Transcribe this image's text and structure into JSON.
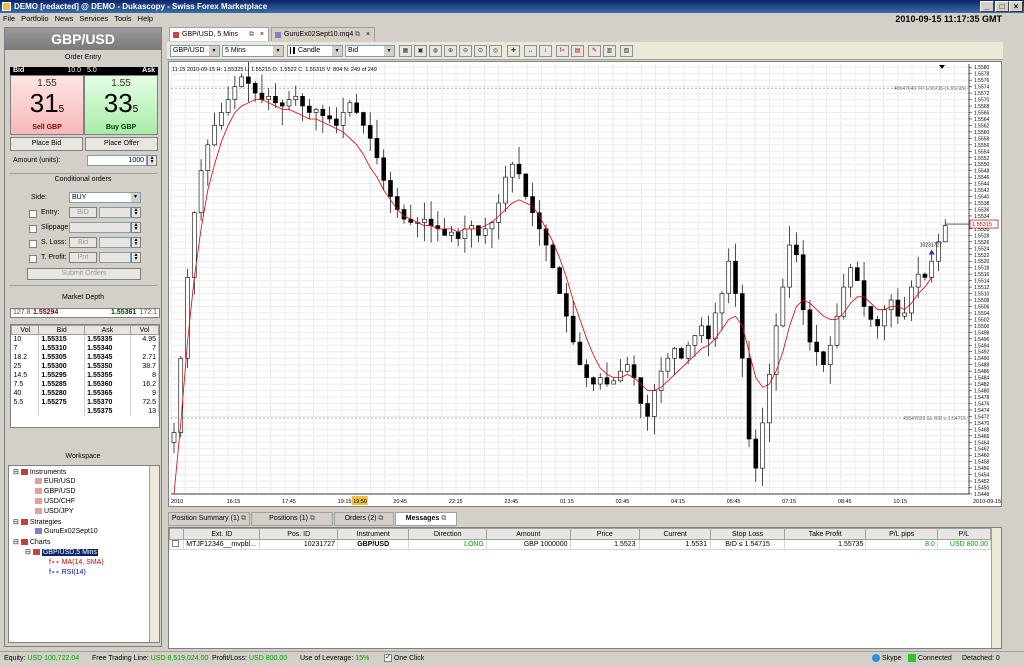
{
  "window": {
    "title": "DEMO [redacted] @ DEMO - Dukascopy - Swiss Forex Marketplace",
    "datetime": "2010-09-15 11:17:35 GMT"
  },
  "menu": [
    "File",
    "Portfolio",
    "News",
    "Services",
    "Tools",
    "Help"
  ],
  "dealing": {
    "pair": "GBP/USD",
    "order_entry_label": "Order Entry",
    "bid_label": "Bid",
    "bid_size": "10.0",
    "ask_label": "Ask",
    "ask_size": "5.0",
    "bid_small": "1.55",
    "bid_big": "31",
    "bid_pip": "5",
    "sell_label": "Sell GBP",
    "ask_small": "1.55",
    "ask_big": "33",
    "ask_pip": "5",
    "buy_label": "Buy GBP",
    "place_bid": "Place Bid",
    "place_offer": "Place Offer",
    "amount_label": "Amount (units):",
    "amount_value": "1000",
    "conditional_label": "Conditional orders",
    "side_label": "Side:",
    "side_value": "BUY",
    "entry_label": "Entry:",
    "entry_type": "BID",
    "slippage_label": "Slippage:",
    "sl_label": "S. Loss:",
    "sl_type": "Bid",
    "tp_label": "T. Profit:",
    "tp_type": "Pnt",
    "submit_label": "Submit Orders"
  },
  "market_depth": {
    "label": "Market Depth",
    "top_bid_vol": "127.8",
    "top_bid": "1.55294",
    "top_ask": "1.55361",
    "top_ask_vol": "172.1",
    "headers": [
      "Vol",
      "Bid",
      "Ask",
      "Vol"
    ],
    "rows": [
      [
        "10",
        "1.55315",
        "1.55335",
        "4.95"
      ],
      [
        "7",
        "1.55310",
        "1.55340",
        "7"
      ],
      [
        "18.2",
        "1.55305",
        "1.55345",
        "2.71"
      ],
      [
        "25",
        "1.55300",
        "1.55350",
        "38.7"
      ],
      [
        "14.5",
        "1.55295",
        "1.55355",
        "8"
      ],
      [
        "7.5",
        "1.55285",
        "1.55360",
        "16.2"
      ],
      [
        "40",
        "1.55280",
        "1.55365",
        "9"
      ],
      [
        "5.5",
        "1.55275",
        "1.55370",
        "72.5"
      ],
      [
        "",
        "",
        "1.55375",
        "13"
      ]
    ]
  },
  "workspace": {
    "label": "Workspace",
    "instruments_label": "Instruments",
    "instruments": [
      "EUR/USD",
      "GBP/USD",
      "USD/CHF",
      "USD/JPY"
    ],
    "strategies_label": "Strategies",
    "strategies": [
      "GuruEx02Sept10"
    ],
    "charts_label": "Charts",
    "chart_item": "GBP/USD,5 Mins",
    "indicators": [
      "f∘∘ MA(14, SMA)",
      "f∘∘ RSI(14)"
    ]
  },
  "tabs": [
    {
      "label": "GBP/USD, 5 Mins"
    },
    {
      "label": "GuruEx02Sept10.mq4"
    }
  ],
  "toolbar": {
    "instrument": "GBP/USD",
    "period": "5 Mins",
    "type": "Candle",
    "side": "Bid"
  },
  "chart_data": {
    "type": "candlestick",
    "info_line": "11:15 2010-09-15 H: 1.55325 L: 1.55215 O: 1.5522 C: 1.55315 V: 804 N: 249 of 249",
    "y_ticks": [
      "1.5580",
      "1.5578",
      "1.5576",
      "1.5574",
      "1.5572",
      "1.5570",
      "1.5568",
      "1.5566",
      "1.5564",
      "1.5562",
      "1.5560",
      "1.5558",
      "1.5556",
      "1.5554",
      "1.5552",
      "1.5550",
      "1.5548",
      "1.5546",
      "1.5544",
      "1.5542",
      "1.5540",
      "1.5538",
      "1.5536",
      "1.5534",
      "1.5532",
      "1.5530",
      "1.5528",
      "1.5526",
      "1.5524",
      "1.5522",
      "1.5520",
      "1.5518",
      "1.5516",
      "1.5514",
      "1.5512",
      "1.5510",
      "1.5508",
      "1.5506",
      "1.5504",
      "1.5502",
      "1.5500",
      "1.5498",
      "1.5496",
      "1.5494",
      "1.5492",
      "1.5490",
      "1.5488",
      "1.5486",
      "1.5484",
      "1.5482",
      "1.5480",
      "1.5478",
      "1.5476",
      "1.5474",
      "1.5472",
      "1.5470",
      "1.5468",
      "1.5466",
      "1.5464",
      "1.5462",
      "1.5460",
      "1.5458",
      "1.5456",
      "1.5454",
      "1.5452",
      "1.5450",
      "1.5448"
    ],
    "ylim": [
      1.5448,
      1.5581
    ],
    "x_ticks": [
      "2010",
      "16:15",
      "17:45",
      "19:15",
      "20:45",
      "22:15",
      "23:45",
      "01:15",
      "02:45",
      "04:15",
      "05:45",
      "07:15",
      "08:45",
      "10:15",
      "2010-09-15"
    ],
    "x_cursor_label": "19:50",
    "current_price_label": "1.55315",
    "current_price": 1.55315,
    "tp_line": {
      "label": "49547640 TP 1.55735 (1.55735)",
      "value": 1.55735
    },
    "sl_line": {
      "label": "49547639 SL BID ≤ 1.54715",
      "value": 1.54715
    },
    "position_label": "10231727",
    "ma_color": "#e00000",
    "up_color": "#ffffff",
    "down_color": "#000000",
    "ma_label": "MA(14, SMA)",
    "close_path": [
      1.5467,
      1.549,
      1.5515,
      1.5535,
      1.5548,
      1.5556,
      1.5562,
      1.5566,
      1.557,
      1.5574,
      1.5577,
      1.5575,
      1.5572,
      1.557,
      1.5571,
      1.5569,
      1.5568,
      1.557,
      1.5571,
      1.5568,
      1.5566,
      1.5567,
      1.5565,
      1.5564,
      1.5562,
      1.5566,
      1.5569,
      1.5566,
      1.5562,
      1.5558,
      1.5552,
      1.5545,
      1.554,
      1.5536,
      1.5533,
      1.5532,
      1.5532,
      1.5533,
      1.5531,
      1.553,
      1.5528,
      1.5529,
      1.5527,
      1.553,
      1.5531,
      1.5528,
      1.553,
      1.5532,
      1.5538,
      1.5546,
      1.555,
      1.5547,
      1.554,
      1.5535,
      1.553,
      1.5525,
      1.5518,
      1.551,
      1.5503,
      1.5495,
      1.5488,
      1.5484,
      1.5482,
      1.5484,
      1.5482,
      1.5483,
      1.5486,
      1.5488,
      1.5484,
      1.5476,
      1.5472,
      1.548,
      1.5486,
      1.549,
      1.5493,
      1.549,
      1.5494,
      1.5497,
      1.55,
      1.5496,
      1.5504,
      1.551,
      1.552,
      1.551,
      1.549,
      1.5465,
      1.5456,
      1.547,
      1.5485,
      1.55,
      1.5512,
      1.5525,
      1.5522,
      1.5505,
      1.5495,
      1.5492,
      1.5488,
      1.5494,
      1.5503,
      1.5512,
      1.5518,
      1.5514,
      1.5506,
      1.5502,
      1.55,
      1.5505,
      1.5508,
      1.5503,
      1.5504,
      1.5512,
      1.5516,
      1.5515,
      1.552,
      1.5526,
      1.5531
    ],
    "ma_path": [
      1.5448,
      1.547,
      1.5495,
      1.5515,
      1.553,
      1.5542,
      1.555,
      1.5557,
      1.5562,
      1.5566,
      1.5568,
      1.5569,
      1.557,
      1.557,
      1.5569,
      1.5568,
      1.5567,
      1.5567,
      1.5566,
      1.5565,
      1.5564,
      1.5564,
      1.5563,
      1.5562,
      1.5561,
      1.556,
      1.5558,
      1.5556,
      1.5553,
      1.5549,
      1.5546,
      1.5542,
      1.5539,
      1.5536,
      1.5534,
      1.5533,
      1.5532,
      1.5531,
      1.5531,
      1.553,
      1.553,
      1.553,
      1.5529,
      1.553,
      1.553,
      1.553,
      1.5531,
      1.5532,
      1.5534,
      1.5536,
      1.5538,
      1.5539,
      1.5538,
      1.5537,
      1.5534,
      1.553,
      1.5526,
      1.5521,
      1.5515,
      1.5508,
      1.5502,
      1.5496,
      1.5491,
      1.5487,
      1.5485,
      1.5484,
      1.5484,
      1.5485,
      1.5484,
      1.5482,
      1.548,
      1.548,
      1.5481,
      1.5483,
      1.5485,
      1.5487,
      1.5489,
      1.5491,
      1.5493,
      1.5494,
      1.5496,
      1.5499,
      1.5502,
      1.5503,
      1.55,
      1.5492,
      1.5484,
      1.5481,
      1.5482,
      1.5486,
      1.5492,
      1.55,
      1.5506,
      1.5508,
      1.5507,
      1.5505,
      1.5503,
      1.5502,
      1.5502,
      1.5504,
      1.5507,
      1.5509,
      1.5509,
      1.5507,
      1.5505,
      1.5505,
      1.5506,
      1.5506,
      1.5505,
      1.5507,
      1.551,
      1.5512,
      1.5515
    ]
  },
  "bottom_tabs": [
    "Position Summary (1)",
    "Positions (1)",
    "Orders (2)",
    "Messages"
  ],
  "positions": {
    "headers": [
      "",
      "Ext. ID",
      "Pos. ID",
      "Instrument",
      "Direction",
      "Amount",
      "Price",
      "Current",
      "Stop Loss",
      "Take Profit",
      "P/L pips",
      "P/L"
    ],
    "rows": [
      [
        "",
        "MTJF12346__mvpbl...",
        "10231727",
        "GBP/USD",
        "LONG",
        "GBP 1000000",
        "1.5523 ",
        "1.5531 ",
        "BID ≤ 1.54715",
        "1.55735",
        "8.0",
        "USD 800.00"
      ]
    ]
  },
  "status": {
    "equity_label": "Equity:",
    "equity": "USD 100,722.04",
    "ftl_label": "Free Trading Line:",
    "ftl": "USD 8,519,024.00",
    "pl_label": "Profit/Loss:",
    "pl": "USD 800.00",
    "lev_label": "Use of Leverage:",
    "lev": "15%",
    "oneclick_label": "One Click",
    "skype": "Skype",
    "connected": "Connected",
    "detached": "Detached: 0"
  }
}
